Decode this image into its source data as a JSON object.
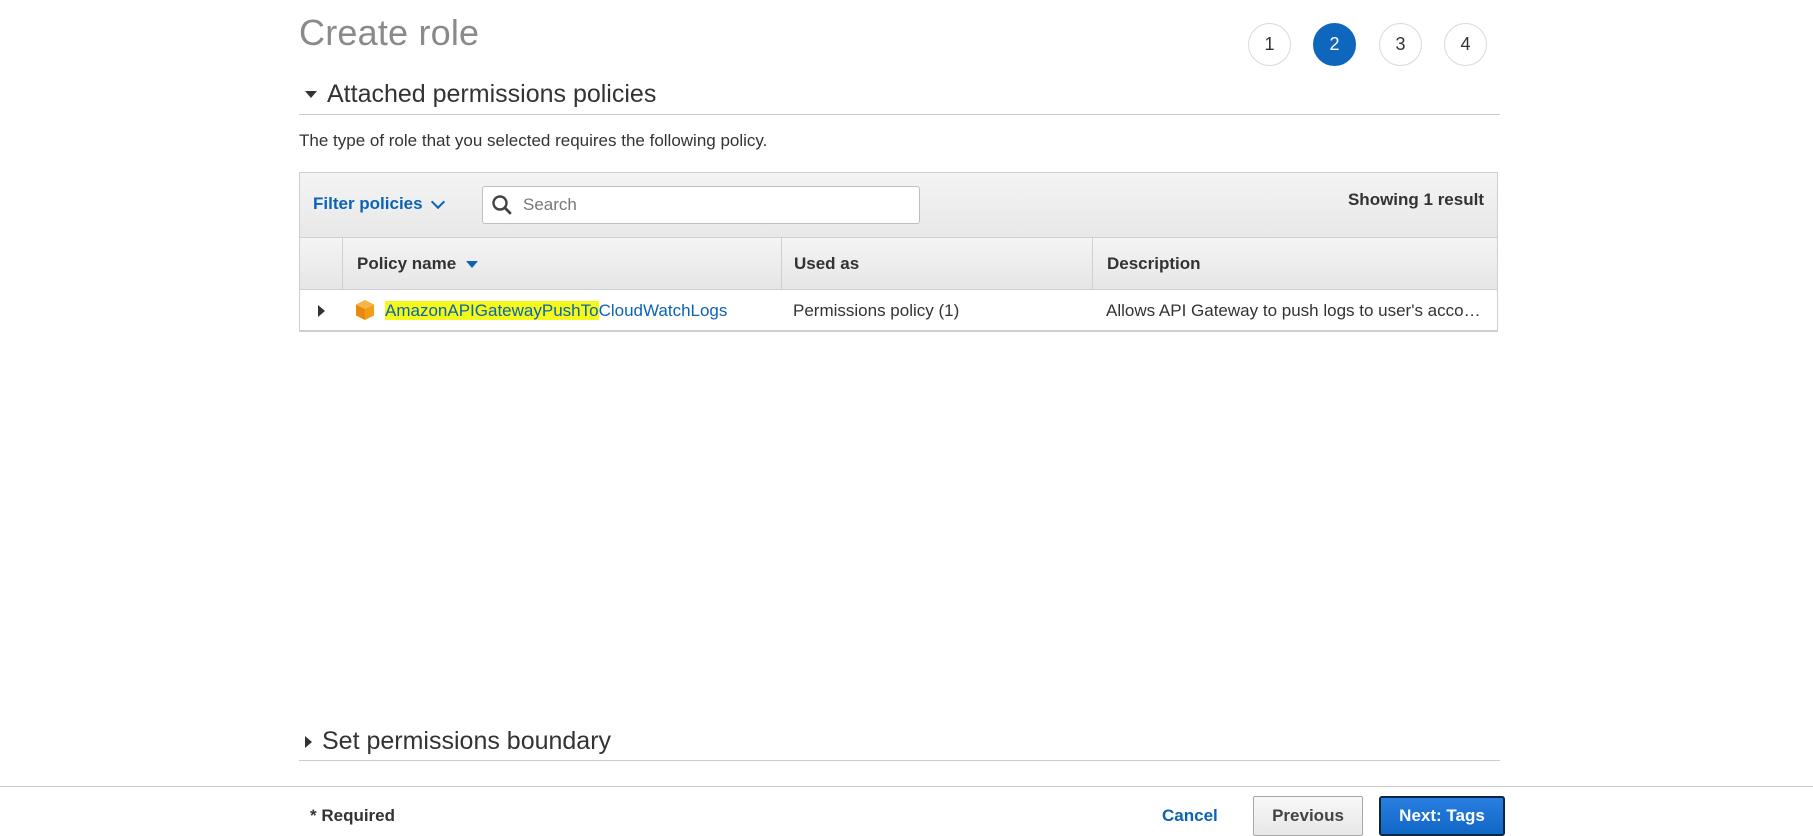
{
  "page_title": "Create role",
  "steps": [
    {
      "label": "1",
      "active": false
    },
    {
      "label": "2",
      "active": true
    },
    {
      "label": "3",
      "active": false
    },
    {
      "label": "4",
      "active": false
    }
  ],
  "attached_section": {
    "title": "Attached permissions policies",
    "description": "The type of role that you selected requires the following policy.",
    "expanded": true
  },
  "toolbar": {
    "filter_label": "Filter policies",
    "search_placeholder": "Search",
    "search_value": "",
    "result_count": "Showing 1 result"
  },
  "table": {
    "columns": [
      "Policy name",
      "Used as",
      "Description"
    ],
    "sorted_column": "Policy name",
    "rows": [
      {
        "policy_name_highlighted": "AmazonAPIGatewayPushTo",
        "policy_name_rest": "CloudWatchLogs",
        "used_as": "Permissions policy (1)",
        "description": "Allows API Gateway to push logs to user's account."
      }
    ]
  },
  "boundary_section": {
    "title": "Set permissions boundary",
    "expanded": false
  },
  "footer": {
    "required_note": "* Required",
    "cancel_label": "Cancel",
    "previous_label": "Previous",
    "next_label": "Next: Tags"
  },
  "colors": {
    "accent": "#0f67bd",
    "link": "#0b63b6",
    "highlight": "#f5f91a",
    "policy_icon": "#f29d15"
  },
  "icons": {
    "search": "search-icon",
    "policy": "aws-policy-cube-icon",
    "expand": "caret-right-icon",
    "collapse": "caret-down-icon"
  }
}
